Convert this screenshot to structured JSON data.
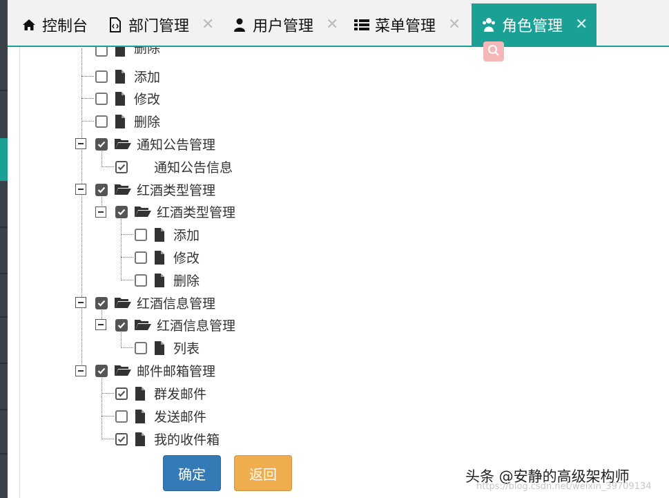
{
  "colors": {
    "accent": "#1aa094",
    "primary": "#337ab7",
    "warning": "#f0ad4e"
  },
  "tabs": [
    {
      "label": "控制台",
      "icon": "home-icon",
      "closable": false,
      "active": false
    },
    {
      "label": "部门管理",
      "icon": "code-file-icon",
      "closable": true,
      "active": false
    },
    {
      "label": "用户管理",
      "icon": "user-icon",
      "closable": true,
      "active": false
    },
    {
      "label": "菜单管理",
      "icon": "list-icon",
      "closable": true,
      "active": false
    },
    {
      "label": "角色管理",
      "icon": "users-icon",
      "closable": true,
      "active": true
    }
  ],
  "tab_close_glyph": "✕",
  "tree": {
    "cut_top_label": "删除",
    "rows": [
      {
        "label": "添加",
        "type": "file",
        "checked": false
      },
      {
        "label": "修改",
        "type": "file",
        "checked": false
      },
      {
        "label": "删除",
        "type": "file",
        "checked": false
      },
      {
        "label": "通知公告管理",
        "type": "folder",
        "checked": true
      },
      {
        "label": "通知公告信息",
        "type": "leaf",
        "checked": true
      },
      {
        "label": "红酒类型管理",
        "type": "folder",
        "checked": true
      },
      {
        "label": "红酒类型管理",
        "type": "folder",
        "checked": true
      },
      {
        "label": "添加",
        "type": "file",
        "checked": false
      },
      {
        "label": "修改",
        "type": "file",
        "checked": false
      },
      {
        "label": "删除",
        "type": "file",
        "checked": false
      },
      {
        "label": "红酒信息管理",
        "type": "folder",
        "checked": true
      },
      {
        "label": "红酒信息管理",
        "type": "folder",
        "checked": true
      },
      {
        "label": "列表",
        "type": "file",
        "checked": false
      },
      {
        "label": "邮件邮箱管理",
        "type": "folder",
        "checked": true
      },
      {
        "label": "群发邮件",
        "type": "file",
        "checked": true
      },
      {
        "label": "发送邮件",
        "type": "file",
        "checked": false
      },
      {
        "label": "我的收件箱",
        "type": "file",
        "checked": true
      }
    ]
  },
  "buttons": {
    "confirm": "确定",
    "back": "返回"
  },
  "watermark": {
    "text": "头条 @安静的高级架构师",
    "url": "https://blog.csdn.net/weixin_39709134"
  }
}
